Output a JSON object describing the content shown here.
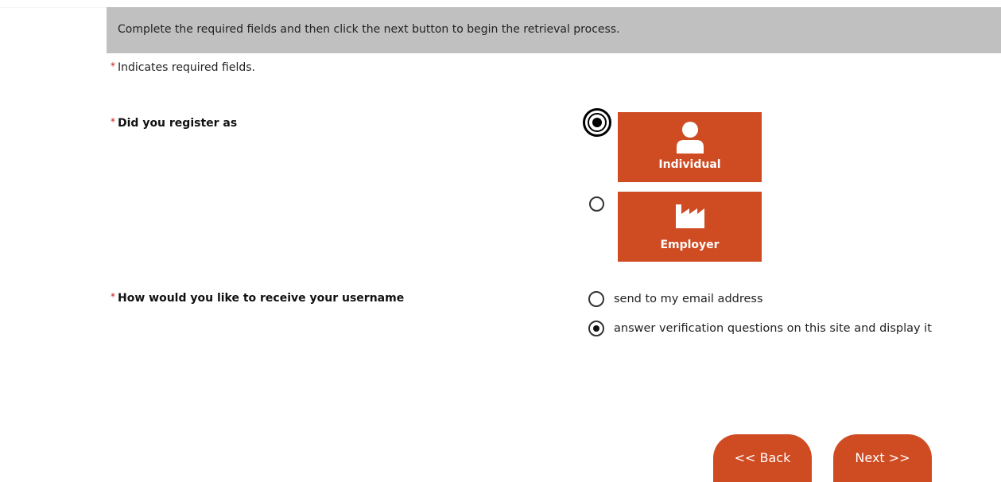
{
  "banner": {
    "instruction": "Complete the required fields and then click the next button to begin the retrieval process."
  },
  "required_note": {
    "marker": "*",
    "text": "Indicates required fields."
  },
  "registration": {
    "marker": "*",
    "question": "Did you register as",
    "selected": "Individual",
    "options": [
      {
        "label": "Individual",
        "icon": "person-icon",
        "checked": true
      },
      {
        "label": "Employer",
        "icon": "factory-icon",
        "checked": false
      }
    ]
  },
  "delivery": {
    "marker": "*",
    "question": "How would you like to receive your username",
    "options": [
      {
        "label": "send to my email address",
        "checked": false
      },
      {
        "label": "answer verification questions on this site and display it",
        "checked": true
      }
    ]
  },
  "navigation": {
    "back_label": "<< Back",
    "next_label": "Next >>"
  },
  "colors": {
    "accent": "#cf4b22",
    "banner_bg": "#c0c0c0",
    "required_marker": "#c41e1e"
  }
}
